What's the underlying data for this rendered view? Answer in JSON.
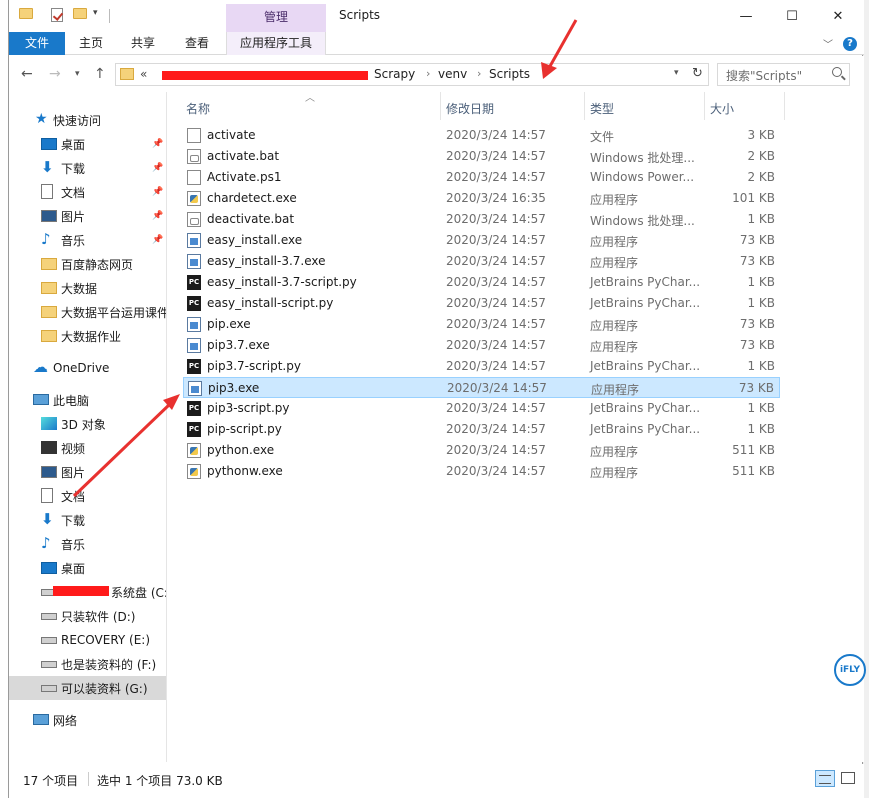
{
  "titlebar": {
    "context_tab": "管理",
    "title": "Scripts",
    "minimize": "—",
    "maximize": "☐",
    "close": "✕"
  },
  "ribbon": {
    "tabs": [
      "文件",
      "主页",
      "共享",
      "查看",
      "应用程序工具"
    ],
    "help": "?"
  },
  "address": {
    "overflow": "«",
    "crumbs": [
      "Scrapy",
      "venv",
      "Scripts"
    ],
    "search_placeholder": "搜索\"Scripts\""
  },
  "sidebar": {
    "quick_access": "快速访问",
    "quick_items": [
      {
        "label": "桌面",
        "icon": "desktop-icon",
        "pinned": true
      },
      {
        "label": "下载",
        "icon": "download-icon",
        "pinned": true
      },
      {
        "label": "文档",
        "icon": "document-icon",
        "pinned": true
      },
      {
        "label": "图片",
        "icon": "pictures-icon",
        "pinned": true
      },
      {
        "label": "音乐",
        "icon": "music-icon",
        "pinned": true
      },
      {
        "label": "百度静态网页",
        "icon": "folder-icon",
        "pinned": false
      },
      {
        "label": "大数据",
        "icon": "folder-icon",
        "pinned": false
      },
      {
        "label": "大数据平台运用课件",
        "icon": "folder-icon",
        "pinned": false
      },
      {
        "label": "大数据作业",
        "icon": "folder-icon",
        "pinned": false
      }
    ],
    "onedrive": "OneDrive",
    "this_pc": "此电脑",
    "pc_items": [
      {
        "label": "3D 对象",
        "icon": "3d-objects-icon"
      },
      {
        "label": "视频",
        "icon": "video-icon"
      },
      {
        "label": "图片",
        "icon": "pictures-icon"
      },
      {
        "label": "文档",
        "icon": "document-icon"
      },
      {
        "label": "下载",
        "icon": "download-icon"
      },
      {
        "label": "音乐",
        "icon": "music-icon"
      },
      {
        "label": "桌面",
        "icon": "desktop-icon"
      }
    ],
    "drives": [
      {
        "label": "系统盘 (C:"
      },
      {
        "label": "只装软件 (D:)"
      },
      {
        "label": "RECOVERY (E:)"
      },
      {
        "label": "也是装资料的 (F:)"
      },
      {
        "label": "可以装资料 (G:)"
      }
    ],
    "network": "网络"
  },
  "columns": {
    "name": "名称",
    "date": "修改日期",
    "type": "类型",
    "size": "大小"
  },
  "files": [
    {
      "name": "activate",
      "date": "2020/3/24 14:57",
      "type": "文件",
      "size": "3 KB",
      "icon": "doc"
    },
    {
      "name": "activate.bat",
      "date": "2020/3/24 14:57",
      "type": "Windows 批处理...",
      "size": "2 KB",
      "icon": "bat"
    },
    {
      "name": "Activate.ps1",
      "date": "2020/3/24 14:57",
      "type": "Windows Power...",
      "size": "2 KB",
      "icon": "doc"
    },
    {
      "name": "chardetect.exe",
      "date": "2020/3/24 16:35",
      "type": "应用程序",
      "size": "101 KB",
      "icon": "pye"
    },
    {
      "name": "deactivate.bat",
      "date": "2020/3/24 14:57",
      "type": "Windows 批处理...",
      "size": "1 KB",
      "icon": "bat"
    },
    {
      "name": "easy_install.exe",
      "date": "2020/3/24 14:57",
      "type": "应用程序",
      "size": "73 KB",
      "icon": "exe"
    },
    {
      "name": "easy_install-3.7.exe",
      "date": "2020/3/24 14:57",
      "type": "应用程序",
      "size": "73 KB",
      "icon": "exe"
    },
    {
      "name": "easy_install-3.7-script.py",
      "date": "2020/3/24 14:57",
      "type": "JetBrains PyChar...",
      "size": "1 KB",
      "icon": "py"
    },
    {
      "name": "easy_install-script.py",
      "date": "2020/3/24 14:57",
      "type": "JetBrains PyChar...",
      "size": "1 KB",
      "icon": "py"
    },
    {
      "name": "pip.exe",
      "date": "2020/3/24 14:57",
      "type": "应用程序",
      "size": "73 KB",
      "icon": "exe"
    },
    {
      "name": "pip3.7.exe",
      "date": "2020/3/24 14:57",
      "type": "应用程序",
      "size": "73 KB",
      "icon": "exe"
    },
    {
      "name": "pip3.7-script.py",
      "date": "2020/3/24 14:57",
      "type": "JetBrains PyChar...",
      "size": "1 KB",
      "icon": "py"
    },
    {
      "name": "pip3.exe",
      "date": "2020/3/24 14:57",
      "type": "应用程序",
      "size": "73 KB",
      "icon": "exe",
      "selected": true
    },
    {
      "name": "pip3-script.py",
      "date": "2020/3/24 14:57",
      "type": "JetBrains PyChar...",
      "size": "1 KB",
      "icon": "py"
    },
    {
      "name": "pip-script.py",
      "date": "2020/3/24 14:57",
      "type": "JetBrains PyChar...",
      "size": "1 KB",
      "icon": "py"
    },
    {
      "name": "python.exe",
      "date": "2020/3/24 14:57",
      "type": "应用程序",
      "size": "511 KB",
      "icon": "pye"
    },
    {
      "name": "pythonw.exe",
      "date": "2020/3/24 14:57",
      "type": "应用程序",
      "size": "511 KB",
      "icon": "pye"
    }
  ],
  "status": {
    "count": "17 个项目",
    "selection": "选中 1 个项目 73.0 KB"
  },
  "ifly": "iFLY",
  "colors": {
    "accent": "#1979ca",
    "selection_bg": "#cce8ff",
    "annotation_red": "#e8312f",
    "context_tab": "#e8d8f4"
  }
}
